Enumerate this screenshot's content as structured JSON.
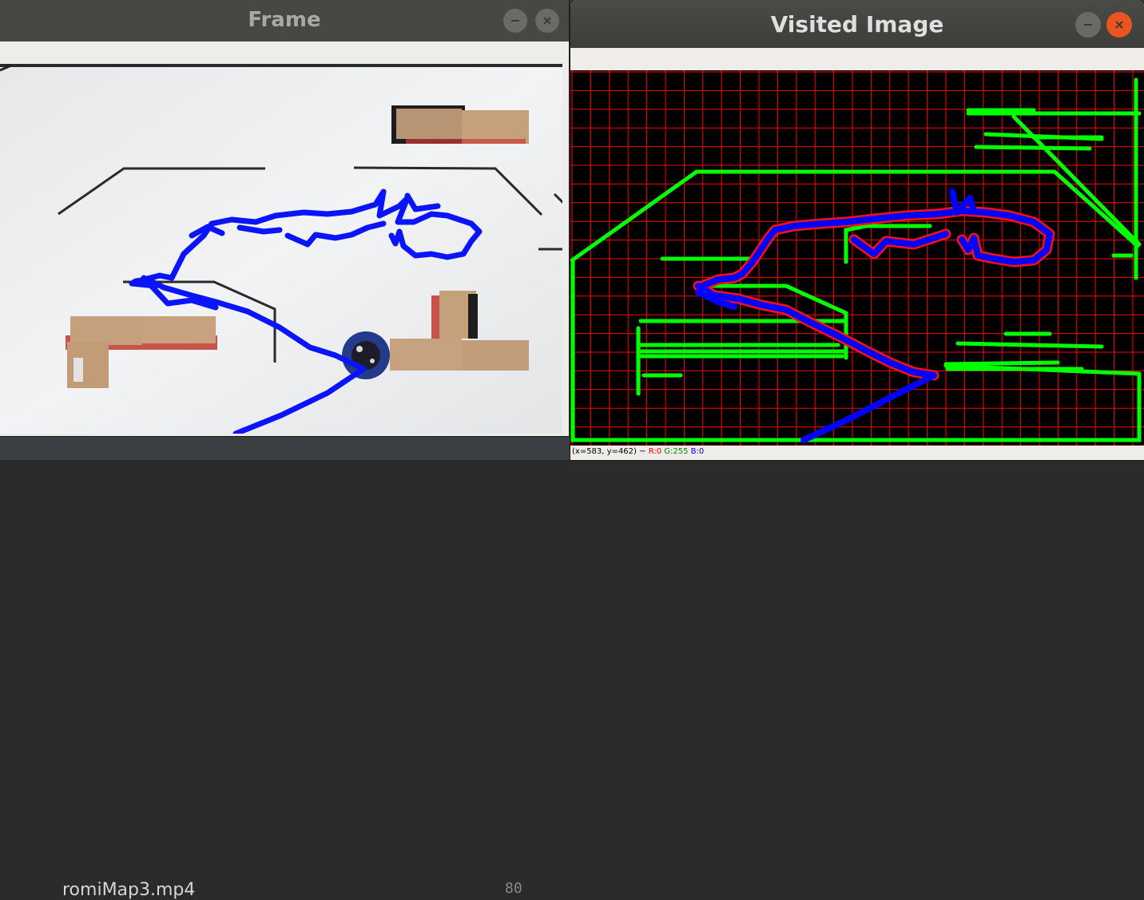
{
  "taskbar": {
    "file_name": "romiMap3.mp4",
    "line_number": "80"
  },
  "frame_window": {
    "title": "Frame",
    "buttons": {
      "minimize_icon": "minus",
      "close_icon": "x"
    }
  },
  "visited_window": {
    "title": "Visited Image",
    "buttons": {
      "minimize_icon": "minus",
      "close_icon": "x"
    },
    "status": {
      "coords": "(x=583, y=462) ~",
      "r": "R:0",
      "g": "G:255",
      "b": "B:0"
    }
  },
  "colors": {
    "path": "#0000ff",
    "walls": "#00ff00",
    "grid": "#ff0000",
    "close_active": "#e9541f"
  }
}
